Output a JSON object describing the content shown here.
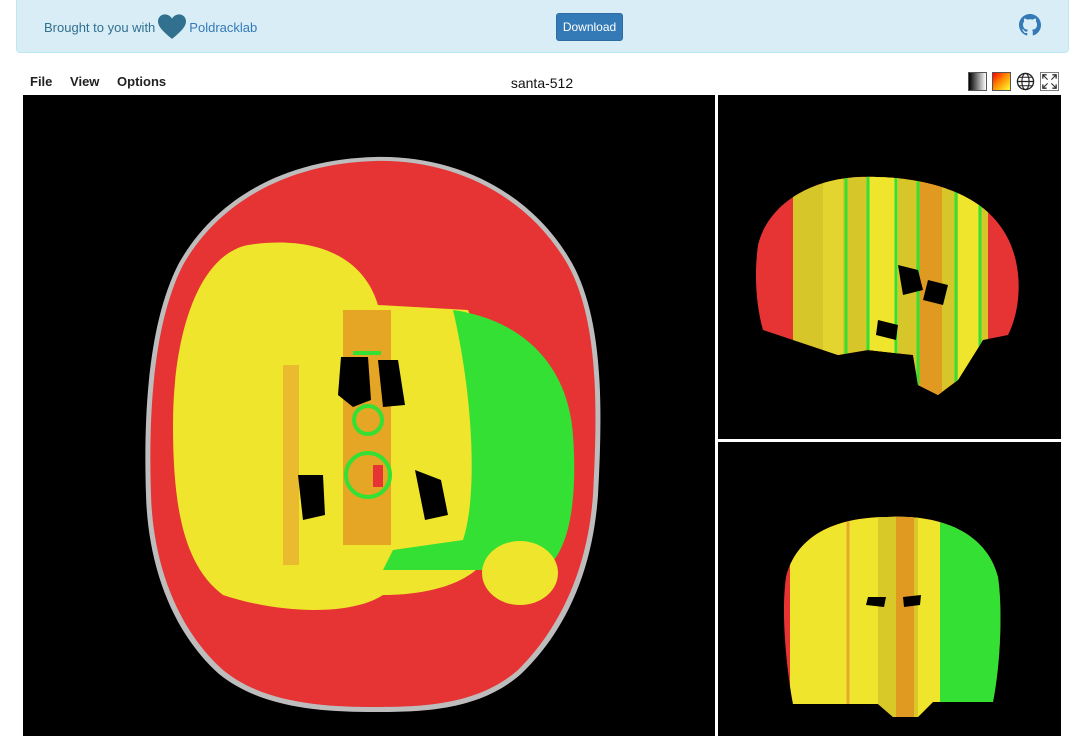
{
  "banner": {
    "credit_prefix": "Brought to you with",
    "credit_lab": "Poldracklab",
    "heart_icon": "heart-icon",
    "download_label": "Download",
    "github_icon": "github-icon"
  },
  "menu": {
    "file": "File",
    "view": "View",
    "options": "Options"
  },
  "viewer": {
    "title": "santa-512",
    "tools": [
      "grayscale-colormap-icon",
      "hot-colormap-icon",
      "globe-icon",
      "fullscreen-icon"
    ]
  },
  "colors": {
    "banner_bg": "#d9edf7",
    "button": "#337ab7",
    "label_red": "#e83030",
    "label_yellow": "#f0e62a",
    "label_green": "#2fe02f",
    "label_orange": "#e09a22"
  }
}
